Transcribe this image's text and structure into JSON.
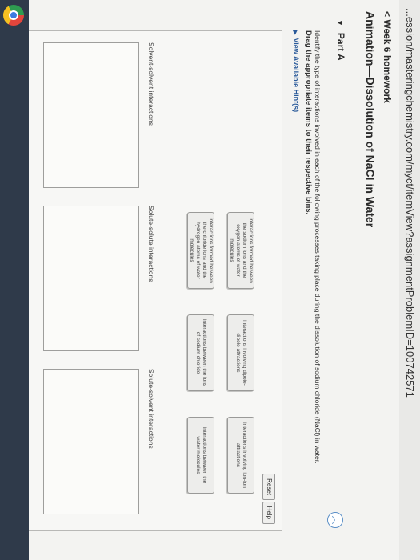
{
  "browser": {
    "url": "...ession/masteringchemistry.com/myct/itemView?assignmentProblemID=100742571"
  },
  "header": {
    "back_link": "< Week 6 homework",
    "title": "Animation—Dissolution of NaCl in Water"
  },
  "part": {
    "label": "Part A",
    "collapse_icon": "chevron-up-icon",
    "instruction": "Identify the type of interactions involved in each of the following processes taking place during the dissolution of sodium chloride (NaCl) in water.",
    "drag_instruction": "Drag the appropriate items to their respective bins.",
    "hints_link": "View Available Hint(s)"
  },
  "controls": {
    "reset_label": "Reset",
    "help_label": "Help"
  },
  "items": [
    {
      "text": "interactions formed between the sodium ions and the oxygen atoms of water molecules"
    },
    {
      "text": "interactions involving dipole-dipole attractions"
    },
    {
      "text": "interactions involving ion-ion attractions"
    },
    {
      "text": "interactions formed between the chloride ions and the hydrogen atoms of water molecules"
    },
    {
      "text": "interactions between the ions of sodium chloride"
    },
    {
      "text": "interactions between the water molecules"
    }
  ],
  "bins": [
    {
      "label": "Solvent-solvent interactions"
    },
    {
      "label": "Solute-solute interactions"
    },
    {
      "label": "Solute-solvent interactions"
    }
  ]
}
